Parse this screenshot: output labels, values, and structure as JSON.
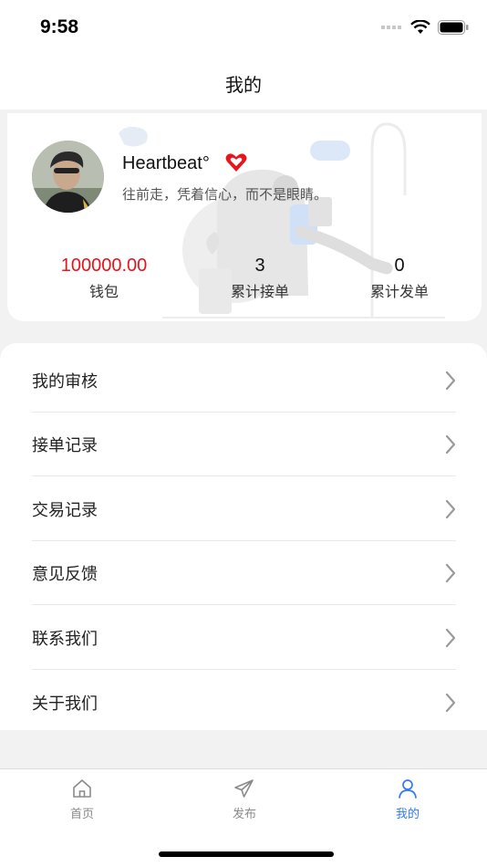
{
  "status_bar": {
    "time": "9:58"
  },
  "header": {
    "title": "我的"
  },
  "profile": {
    "username": "Heartbeat°",
    "signature": "往前走，凭着信心，而不是眼睛。"
  },
  "stats": [
    {
      "value": "100000.00",
      "label": "钱包"
    },
    {
      "value": "3",
      "label": "累计接单"
    },
    {
      "value": "0",
      "label": "累计发单"
    }
  ],
  "menu": [
    {
      "label": "我的审核"
    },
    {
      "label": "接单记录"
    },
    {
      "label": "交易记录"
    },
    {
      "label": "意见反馈"
    },
    {
      "label": "联系我们"
    },
    {
      "label": "关于我们"
    }
  ],
  "tabs": [
    {
      "label": "首页",
      "icon": "home-icon"
    },
    {
      "label": "发布",
      "icon": "send-icon"
    },
    {
      "label": "我的",
      "icon": "user-icon",
      "active": true
    }
  ],
  "colors": {
    "accent": "#2f7cf6",
    "wallet": "#e8131b",
    "vip": "#e8131b"
  }
}
